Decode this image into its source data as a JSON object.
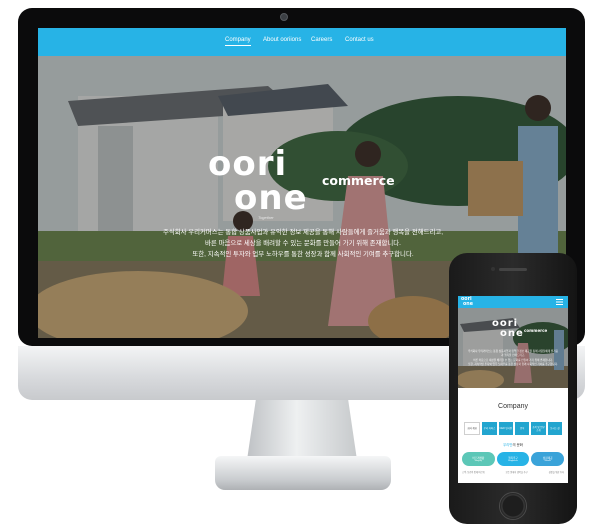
{
  "site": {
    "nav": [
      "Company",
      "About ooriions",
      "Careers",
      "Contact us"
    ],
    "active_nav": "Company",
    "logo": {
      "line1": "oori",
      "line2": "one",
      "suffix": "commerce",
      "tagline": "Together"
    },
    "hero_lines": [
      "주식회사 우리커머스는 통합 상품사업과 유익한 정보 제공을 통해 사람들에게 즐거움과 행복을 전해드리고,",
      "바른 마음으로 세상을 배려할 수 있는 문화를 만들어 가기 위해 존재합니다.",
      "또한, 지속적인 투자와 업무 노하우를 통한 성장과 함께 사회적인 기여를 추구합니다."
    ]
  },
  "mobile": {
    "section_title": "Company",
    "tabs": [
      "회사\n개요",
      "우리\n커머스",
      "CEO\n인사말",
      "연혁",
      "조직 및\n업무소개",
      "오시는\n길"
    ],
    "culture_title_highlight": "우리만",
    "culture_title_rest": "의 문화",
    "pills": [
      {
        "title": "바르게생활",
        "sub": "Integrity",
        "color": "#5cc7b7"
      },
      {
        "title": "행복추구",
        "sub": "Happiness",
        "color": "#27b3e6"
      },
      {
        "title": "성장제공",
        "sub": "Growth",
        "color": "#3aa3d9"
      }
    ],
    "notes": [
      "고객, 동료와 함께 바르게",
      "모든 일에서 행복을 추구",
      "성장을 위한 투자"
    ]
  },
  "colors": {
    "accent": "#27b3e6",
    "device_black": "#0b0b0c",
    "silver": "#d7d9dc"
  }
}
